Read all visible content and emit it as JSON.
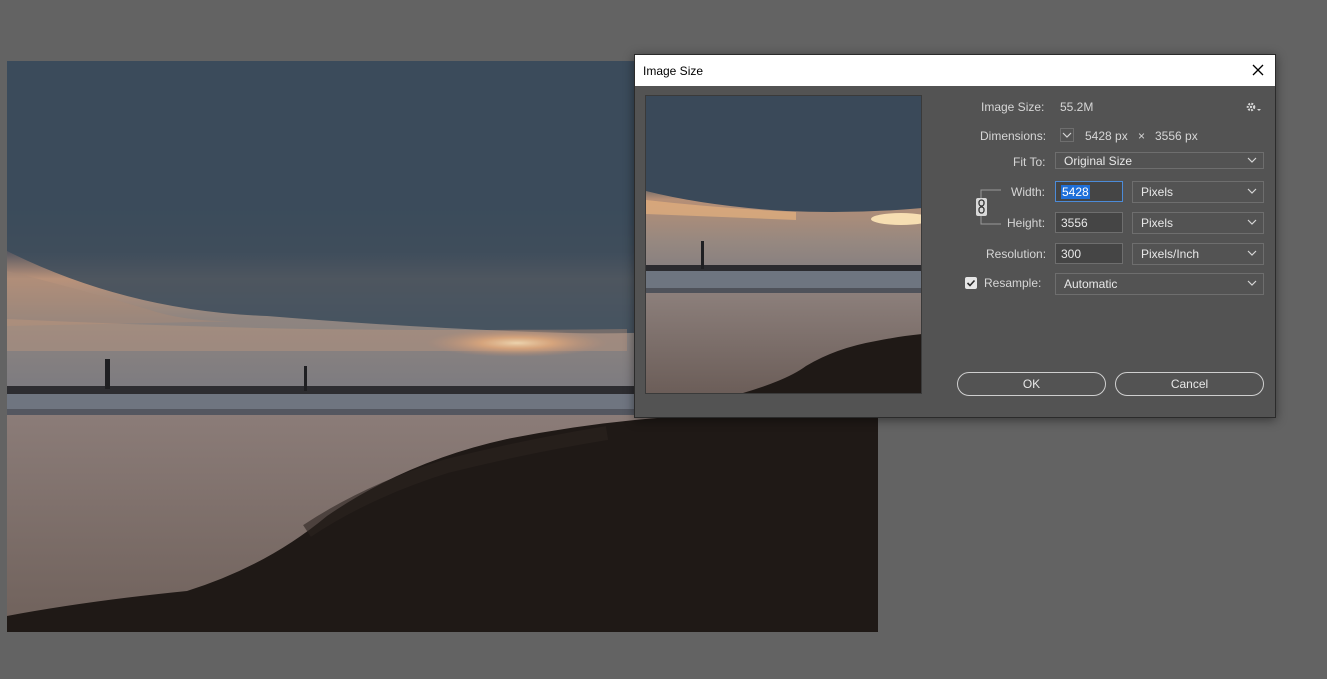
{
  "dialog": {
    "title": "Image Size",
    "image_size_label": "Image Size:",
    "image_size_value": "55.2M",
    "dimensions_label": "Dimensions:",
    "dim_width": "5428 px",
    "dim_times": "×",
    "dim_height": "3556 px",
    "fit_to_label": "Fit To:",
    "fit_to_value": "Original Size",
    "width_label": "Width:",
    "width_value": "5428",
    "width_unit": "Pixels",
    "height_label": "Height:",
    "height_value": "3556",
    "height_unit": "Pixels",
    "resolution_label": "Resolution:",
    "resolution_value": "300",
    "resolution_unit": "Pixels/Inch",
    "resample_label": "Resample:",
    "resample_checked": true,
    "resample_value": "Automatic",
    "ok_label": "OK",
    "cancel_label": "Cancel"
  },
  "icons": [
    "close-icon",
    "gear-icon",
    "chevron-down-icon",
    "link-chain-icon",
    "checkmark-icon"
  ],
  "colors": {
    "workspace_bg": "#636363",
    "dialog_bg": "#535353",
    "titlebar_bg": "#ffffff",
    "selection": "#1e6fd9"
  }
}
